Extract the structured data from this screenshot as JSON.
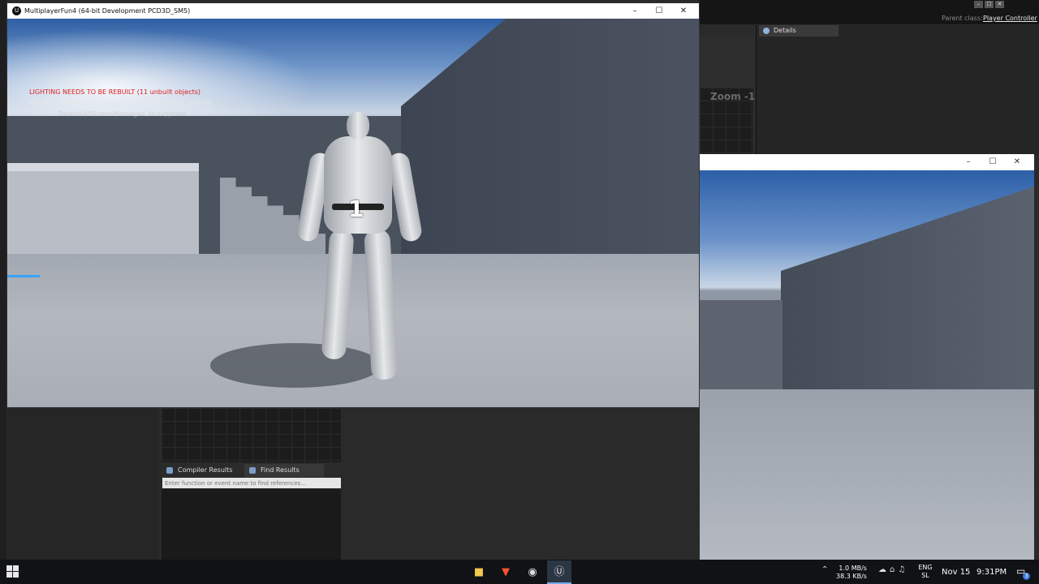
{
  "editor": {
    "parent_class_label": "Parent class:",
    "parent_class_value": "Player Controller",
    "details_tab": "Details",
    "zoom_label": "Zoom -1",
    "compiler_results_tab": "Compiler Results",
    "find_results_tab": "Find Results",
    "find_placeholder": "Enter function or event name to find references..."
  },
  "game_window_1": {
    "title": "MultiplayerFun4 (64-bit Development PCD3D_SM5)",
    "messages": {
      "lighting": "LIGHTING NEEDS TO BE REBUILT (11 unbuilt objects)",
      "reflection": "REFLECTION CAPTURES NEED TO BE REBUILT (1 unbuilt)",
      "suppress": "DisableAllScreenMessages' to suppress"
    },
    "player_number": "1",
    "controls": {
      "minimize": "–",
      "maximize": "☐",
      "close": "✕"
    }
  },
  "game_window_2": {
    "controls": {
      "minimize": "–",
      "maximize": "☐",
      "close": "✕"
    }
  },
  "taskbar": {
    "apps": [
      "explorer-icon",
      "brave-icon",
      "obs-icon",
      "unreal-icon"
    ],
    "network_up": "1.0 MB/s",
    "network_down": "38.3 KB/s",
    "lang_top": "ENG",
    "lang_bottom": "SL",
    "date": "Nov 15",
    "time": "9:31PM",
    "notification_count": "3"
  }
}
